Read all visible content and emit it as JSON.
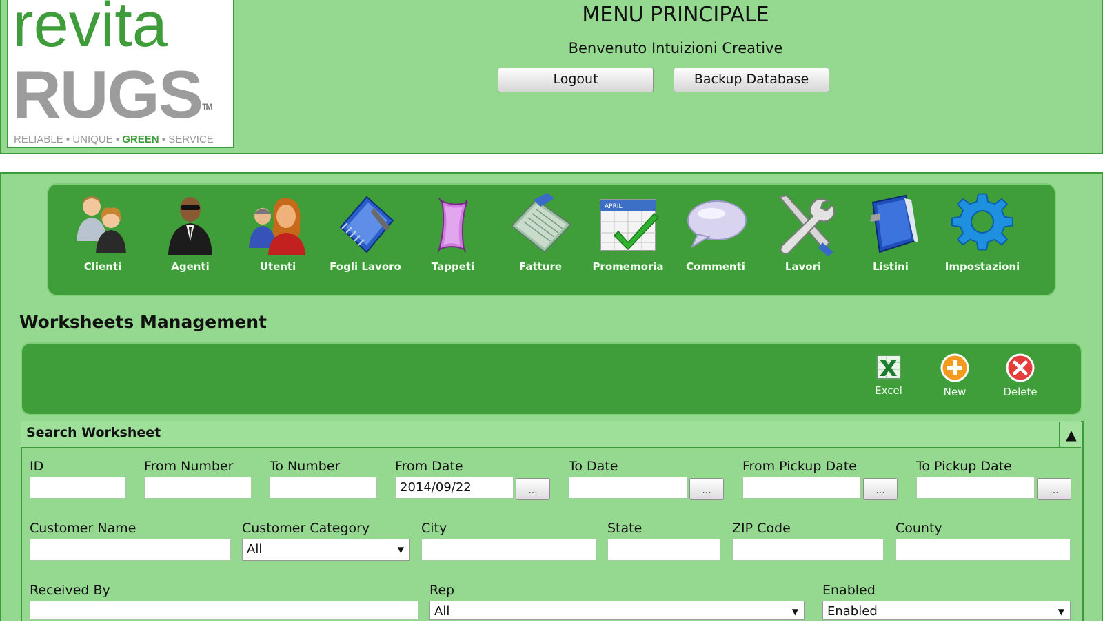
{
  "logo": {
    "line1": "revita",
    "line2": "RUGS",
    "trademark": "TM",
    "tag1": "RELIABLE",
    "tag2": "UNIQUE",
    "tag3": "GREEN",
    "tag4": "SERVICE",
    "sep": "•"
  },
  "header": {
    "title": "MENU PRINCIPALE",
    "welcome": "Benvenuto Intuizioni Creative",
    "logout_label": "Logout",
    "backup_label": "Backup Database"
  },
  "nav": [
    {
      "label": "Clienti",
      "icon": "clients-icon"
    },
    {
      "label": "Agenti",
      "icon": "agent-icon"
    },
    {
      "label": "Utenti",
      "icon": "users-icon"
    },
    {
      "label": "Fogli Lavoro",
      "icon": "notebook-icon"
    },
    {
      "label": "Tappeti",
      "icon": "rug-icon"
    },
    {
      "label": "Fatture",
      "icon": "invoice-icon"
    },
    {
      "label": "Promemoria",
      "icon": "calendar-icon"
    },
    {
      "label": "Commenti",
      "icon": "speech-bubble-icon"
    },
    {
      "label": "Lavori",
      "icon": "tools-icon"
    },
    {
      "label": "Listini",
      "icon": "binder-icon"
    },
    {
      "label": "Impostazioni",
      "icon": "gear-icon"
    }
  ],
  "section": {
    "title": "Worksheets Management"
  },
  "toolbar": {
    "excel_label": "Excel",
    "new_label": "New",
    "delete_label": "Delete",
    "calendar_month": "APRIL"
  },
  "search": {
    "title": "Search Worksheet",
    "collapse_glyph": "▲",
    "dots": "...",
    "fields": {
      "id": {
        "label": "ID",
        "value": ""
      },
      "from_number": {
        "label": "From Number",
        "value": ""
      },
      "to_number": {
        "label": "To Number",
        "value": ""
      },
      "from_date": {
        "label": "From Date",
        "value": "2014/09/22"
      },
      "to_date": {
        "label": "To Date",
        "value": ""
      },
      "from_pickup_date": {
        "label": "From Pickup Date",
        "value": ""
      },
      "to_pickup_date": {
        "label": "To Pickup Date",
        "value": ""
      },
      "customer_name": {
        "label": "Customer Name",
        "value": ""
      },
      "customer_category": {
        "label": "Customer Category",
        "value": "All"
      },
      "city": {
        "label": "City",
        "value": ""
      },
      "state": {
        "label": "State",
        "value": ""
      },
      "zip_code": {
        "label": "ZIP Code",
        "value": ""
      },
      "county": {
        "label": "County",
        "value": ""
      },
      "received_by": {
        "label": "Received By",
        "value": ""
      },
      "rep": {
        "label": "Rep",
        "value": "All"
      },
      "enabled": {
        "label": "Enabled",
        "value": "Enabled"
      }
    }
  },
  "colors": {
    "panel_green": "#94d98f",
    "bar_green": "#3f9e3a",
    "border_green": "#3c9a3a"
  }
}
